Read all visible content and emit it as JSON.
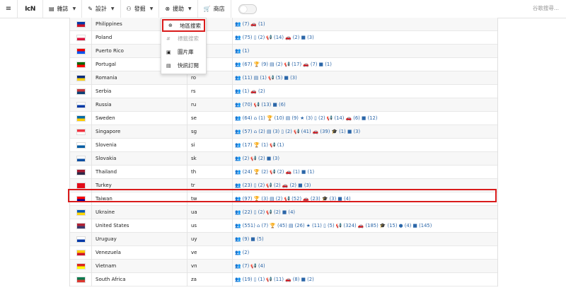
{
  "navbar": {
    "hamburger_icon": "≡",
    "logo": "IcN",
    "items": [
      {
        "icon": "▤",
        "label": "雜誌"
      },
      {
        "icon": "✎",
        "label": "設計"
      },
      {
        "icon": "⚇",
        "label": "發掘"
      },
      {
        "icon": "⊗",
        "label": "援助"
      },
      {
        "icon": "🛒",
        "label": "商店"
      }
    ],
    "search_placeholder": "谷歌搜尋..."
  },
  "dropdown": {
    "items": [
      {
        "icon": "⊕",
        "label": "地區搜索"
      },
      {
        "icon": "#",
        "label": "標籤搜索"
      },
      {
        "icon": "▣",
        "label": "圖片庫"
      },
      {
        "icon": "▤",
        "label": "快訊訂閱"
      }
    ]
  },
  "rows": [
    {
      "name": "Philippines",
      "code": "",
      "stats": "👥 (7)  🚗 (1)",
      "flag": [
        "#0038a8",
        "#ce1126"
      ]
    },
    {
      "name": "Poland",
      "code": "",
      "stats": "👥 (75)  ▯ (2)  📢 (14)  🚗 (2)  ■ (3)",
      "flag": [
        "#ffffff",
        "#dc143c"
      ]
    },
    {
      "name": "Puerto Rico",
      "code": "",
      "stats": "👥 (1)",
      "flag": [
        "#ed0000",
        "#0050f0"
      ]
    },
    {
      "name": "Portugal",
      "code": "",
      "stats": "👥 (67)  🏆 (9)  ▤ (2)  📢 (17)  🚗 (7)  ■ (1)",
      "flag": [
        "#006600",
        "#ff0000"
      ]
    },
    {
      "name": "Romania",
      "code": "ro",
      "stats": "👥 (11)  ▤ (1)  📢 (5)  ■ (3)",
      "flag": [
        "#002b7f",
        "#fcd116"
      ]
    },
    {
      "name": "Serbia",
      "code": "rs",
      "stats": "👥 (1)  🚗 (2)",
      "flag": [
        "#c6363c",
        "#0c4076"
      ]
    },
    {
      "name": "Russia",
      "code": "ru",
      "stats": "👥 (70)  📢 (13)  ■ (6)",
      "flag": [
        "#ffffff",
        "#0039a6"
      ]
    },
    {
      "name": "Sweden",
      "code": "se",
      "stats": "👥 (64)  ⌂ (1)  🏆 (10)  ▤ (9)  ★ (3)  ▯ (2)  📢 (14)  🚗 (6)  ■ (12)",
      "flag": [
        "#006aa7",
        "#fecc00"
      ]
    },
    {
      "name": "Singapore",
      "code": "sg",
      "stats": "👥 (57)  ⌂ (2)  ▤ (3)  ▯ (2)  📢 (41)  🚗 (39)  🎓 (1)  ■ (3)",
      "flag": [
        "#ef3340",
        "#ffffff"
      ]
    },
    {
      "name": "Slovenia",
      "code": "si",
      "stats": "👥 (17)  🏆 (1)  📢 (1)",
      "flag": [
        "#ffffff",
        "#005da4"
      ]
    },
    {
      "name": "Slovakia",
      "code": "sk",
      "stats": "👥 (2)  📢 (2)  ■ (3)",
      "flag": [
        "#ffffff",
        "#0b4ea2"
      ]
    },
    {
      "name": "Thailand",
      "code": "th",
      "stats": "👥 (24)  🏆 (2)  📢 (2)  🚗 (1)  ■ (1)",
      "flag": [
        "#a51931",
        "#2d2a4a"
      ]
    },
    {
      "name": "Turkey",
      "code": "tr",
      "stats": "👥 (23)  ▯ (2)  📢 (2)  🚗 (2)  ■ (3)",
      "flag": [
        "#e30a17",
        "#e30a17"
      ]
    },
    {
      "name": "Taiwan",
      "code": "tw",
      "stats": "👥 (97)  🏆 (3)  ▤ (2)  📢 (52)  🚗 (23)  🎓 (3)  ■ (4)",
      "flag": [
        "#fe0000",
        "#000095"
      ]
    },
    {
      "name": "Ukraine",
      "code": "ua",
      "stats": "👥 (22)  ▯ (2)  📢 (2)  ■ (4)",
      "flag": [
        "#0057b7",
        "#ffd700"
      ]
    },
    {
      "name": "United States",
      "code": "us",
      "stats": "👥 (551)  ⌂ (7)  🏆 (45)  ▤ (26)  ★ (11)  ▯ (5)  📢 (324)  🚗 (185)  🎓 (15)  ● (4)  ■ (145)",
      "flag": [
        "#b22234",
        "#3c3b6e"
      ]
    },
    {
      "name": "Uruguay",
      "code": "uy",
      "stats": "👥 (9)  ■ (5)",
      "flag": [
        "#ffffff",
        "#0038a8"
      ]
    },
    {
      "name": "Venezuela",
      "code": "ve",
      "stats": "👥 (2)",
      "flag": [
        "#ffcc00",
        "#cf142b"
      ]
    },
    {
      "name": "Vietnam",
      "code": "vn",
      "stats": "👥 (7)  📢 (4)",
      "flag": [
        "#da251d",
        "#ffff00"
      ]
    },
    {
      "name": "South Africa",
      "code": "za",
      "stats": "👥 (19)  ▯ (1)  📢 (11)  🚗 (8)  ■ (2)",
      "flag": [
        "#007a4d",
        "#de3831"
      ]
    }
  ],
  "colors": {
    "accent": "#2b66a8",
    "highlight": "#d91b1b"
  }
}
